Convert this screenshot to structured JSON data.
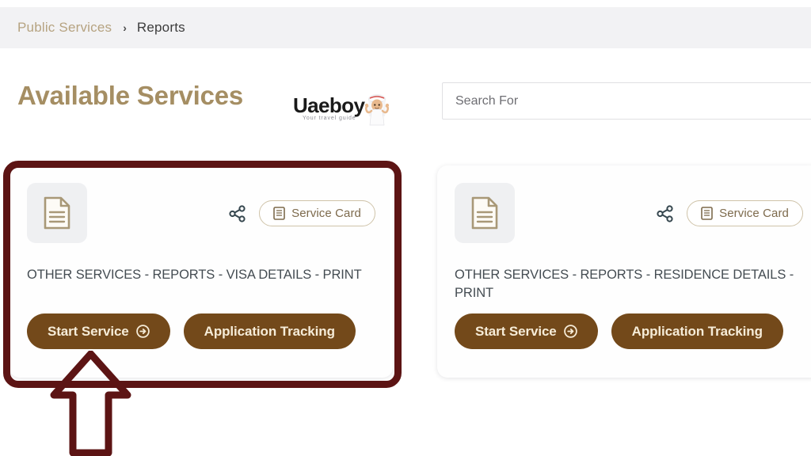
{
  "breadcrumb": {
    "parent": "Public Services",
    "separator": "›",
    "current": "Reports"
  },
  "header": {
    "page_title": "Available Services"
  },
  "logo": {
    "wordmark": "Uaeboy",
    "tagline": "Your travel guide",
    "mascot_icon": "emirati-boy-mascot-icon"
  },
  "search": {
    "value": "",
    "placeholder": "Search For",
    "icon": "search-input"
  },
  "cards": [
    {
      "doc_icon": "document-icon",
      "share_icon": "share-icon",
      "service_card_icon": "card-document-icon",
      "service_card_label": "Service Card",
      "title": "OTHER SERVICES - REPORTS - VISA DETAILS - PRINT",
      "start_label": "Start Service",
      "start_icon": "arrow-right-circle-icon",
      "tracking_label": "Application Tracking",
      "highlighted": true
    },
    {
      "doc_icon": "document-icon",
      "share_icon": "share-icon",
      "service_card_icon": "card-document-icon",
      "service_card_label": "Service Card",
      "title": "OTHER SERVICES - REPORTS - RESIDENCE DETAILS - PRINT",
      "start_label": "Start Service",
      "start_icon": "arrow-right-circle-icon",
      "tracking_label": "Application Tracking",
      "highlighted": false
    }
  ],
  "annotation": {
    "highlight_color": "#5c1414",
    "arrow_icon": "up-arrow-annotation-icon",
    "arrow_color": "#5c1414"
  },
  "colors": {
    "brand_gold": "#a58e63",
    "button_brown": "#73491a",
    "breadcrumb_bar": "#f2f2f4",
    "title_gray": "#444c52"
  }
}
